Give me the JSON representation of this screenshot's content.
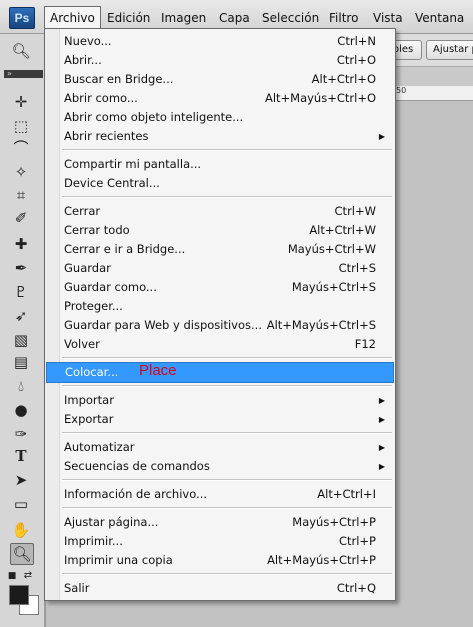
{
  "app": {
    "logo": "Ps"
  },
  "menubar": [
    {
      "label": "Archivo"
    },
    {
      "label": "Edición"
    },
    {
      "label": "Imagen"
    },
    {
      "label": "Capa"
    },
    {
      "label": "Selección"
    },
    {
      "label": "Filtro"
    },
    {
      "label": "Vista"
    },
    {
      "label": "Ventana"
    }
  ],
  "options": {
    "btn1": "oles",
    "btn2": "Ajustar p"
  },
  "ruler": {
    "mark": "50"
  },
  "file_menu": {
    "highlighted": "Colocar...",
    "note": "Place",
    "items": [
      {
        "label": "Nuevo...",
        "shortcut": "Ctrl+N"
      },
      {
        "label": "Abrir...",
        "shortcut": "Ctrl+O"
      },
      {
        "label": "Buscar en Bridge...",
        "shortcut": "Alt+Ctrl+O"
      },
      {
        "label": "Abrir como...",
        "shortcut": "Alt+Mayús+Ctrl+O"
      },
      {
        "label": "Abrir como objeto inteligente...",
        "shortcut": ""
      },
      {
        "label": "Abrir recientes",
        "shortcut": "",
        "submenu": true
      },
      {
        "label": "Compartir mi pantalla...",
        "shortcut": ""
      },
      {
        "label": "Device Central...",
        "shortcut": ""
      },
      {
        "label": "Cerrar",
        "shortcut": "Ctrl+W"
      },
      {
        "label": "Cerrar todo",
        "shortcut": "Alt+Ctrl+W"
      },
      {
        "label": "Cerrar e ir a Bridge...",
        "shortcut": "Mayús+Ctrl+W"
      },
      {
        "label": "Guardar",
        "shortcut": "Ctrl+S"
      },
      {
        "label": "Guardar como...",
        "shortcut": "Mayús+Ctrl+S"
      },
      {
        "label": "Proteger...",
        "shortcut": ""
      },
      {
        "label": "Guardar para Web y dispositivos...",
        "shortcut": "Alt+Mayús+Ctrl+S"
      },
      {
        "label": "Volver",
        "shortcut": "F12"
      },
      {
        "label": "Colocar...",
        "shortcut": ""
      },
      {
        "label": "Importar",
        "shortcut": "",
        "submenu": true
      },
      {
        "label": "Exportar",
        "shortcut": "",
        "submenu": true
      },
      {
        "label": "Automatizar",
        "shortcut": "",
        "submenu": true
      },
      {
        "label": "Secuencias de comandos",
        "shortcut": "",
        "submenu": true
      },
      {
        "label": "Información de archivo...",
        "shortcut": "Alt+Ctrl+I"
      },
      {
        "label": "Ajustar página...",
        "shortcut": "Mayús+Ctrl+P"
      },
      {
        "label": "Imprimir...",
        "shortcut": "Ctrl+P"
      },
      {
        "label": "Imprimir una copia",
        "shortcut": "Alt+Mayús+Ctrl+P"
      },
      {
        "label": "Salir",
        "shortcut": "Ctrl+Q"
      }
    ]
  },
  "colors": {
    "highlight": "#3399ff",
    "note": "#e0001b"
  },
  "tools": [
    "zoom-icon",
    "move-icon",
    "marquee-icon",
    "lasso-icon",
    "magic-wand-icon",
    "crop-icon",
    "eyedropper-icon",
    "healing-brush-icon",
    "brush-icon",
    "clone-stamp-icon",
    "history-brush-icon",
    "eraser-icon",
    "gradient-icon",
    "blur-icon",
    "dodge-icon",
    "pen-icon",
    "type-icon",
    "path-selection-icon",
    "shape-icon",
    "hand-icon",
    "zoom-tool-icon"
  ]
}
